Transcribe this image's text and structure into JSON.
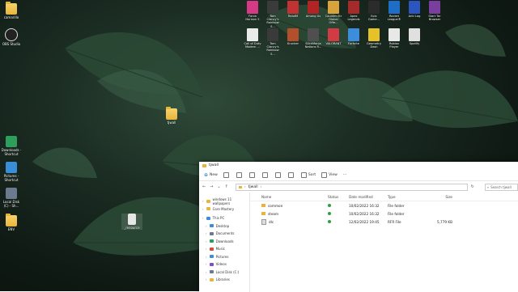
{
  "desktop_left": [
    {
      "label": "camarillo",
      "icon": "folder-icon"
    },
    {
      "label": "OBS Studio",
      "icon": "obs-icon"
    },
    {
      "label": "Downloads - Shortcut",
      "icon": "downloads-icon"
    },
    {
      "label": "Pictures - Shortcut",
      "icon": "pictures-icon"
    },
    {
      "label": "Local Disk (C) - Sh...",
      "icon": "disk-icon"
    },
    {
      "label": "ENV",
      "icon": "folder-icon"
    }
  ],
  "desktop_center": [
    {
      "label": "tjwall",
      "icon": "folder-icon"
    },
    {
      "label": "_resource",
      "icon": "file-icon"
    }
  ],
  "games_row1": [
    {
      "label": "Forza Horizon 5",
      "color": "#d63a87"
    },
    {
      "label": "Tom Clancy's Rainbow S...",
      "color": "#3b3b3b"
    },
    {
      "label": "ReadM",
      "color": "#c33232"
    },
    {
      "label": "Among Us",
      "color": "#b22323"
    },
    {
      "label": "Counter-Str Global Offe...",
      "color": "#d9a33b"
    },
    {
      "label": "Apex Legends",
      "color": "#a52a2a"
    },
    {
      "label": "Epic Game...",
      "color": "#2b2b2b"
    },
    {
      "label": "Rocket League®",
      "color": "#1e6ec8"
    },
    {
      "label": "Anti Lag",
      "color": "#2b55c0"
    },
    {
      "label": "Start Tor Browser",
      "color": "#7a3f9e"
    }
  ],
  "games_row2": [
    {
      "label": "Call of Duty Modern ...",
      "color": "#eaeaea"
    },
    {
      "label": "Tom Clancy's Rainbow S...",
      "color": "#3a3a3a"
    },
    {
      "label": "Krunker",
      "color": "#b44f2c"
    },
    {
      "label": "StickMania Nations R...",
      "color": "#4f4f4f"
    },
    {
      "label": "VALORANT",
      "color": "#d23a44"
    },
    {
      "label": "Fortnite",
      "color": "#3c8ddb"
    },
    {
      "label": "Geometry Dash",
      "color": "#e6c229"
    },
    {
      "label": "Roblox Player",
      "color": "#e8e8e8"
    },
    {
      "label": "Spotify",
      "color": "#e0e0e0"
    }
  ],
  "explorer": {
    "title": "tjwall",
    "new_label": "New",
    "sort_label": "Sort",
    "view_label": "View",
    "more_label": "···",
    "address": "tjwall",
    "search_placeholder": "Search tjwall",
    "nav": [
      {
        "label": "windows 11 wallpapers",
        "color": "#e8b53c"
      },
      {
        "label": "Core Mastery",
        "color": "#e8b53c"
      },
      {
        "label": "This PC",
        "color": "#3a8ed8"
      },
      {
        "label": "Desktop",
        "color": "#3a8ed8"
      },
      {
        "label": "Documents",
        "color": "#6b7a8f"
      },
      {
        "label": "Downloads",
        "color": "#2e9e5b"
      },
      {
        "label": "Music",
        "color": "#d44c3a"
      },
      {
        "label": "Pictures",
        "color": "#3a8ed8"
      },
      {
        "label": "Videos",
        "color": "#7c4fc4"
      },
      {
        "label": "Local Disk (C:)",
        "color": "#6b7a8f"
      },
      {
        "label": "Libraries",
        "color": "#e8b53c"
      }
    ],
    "columns": {
      "name": "Name",
      "status": "Status",
      "date": "Date modified",
      "type": "Type",
      "size": "Size"
    },
    "files": [
      {
        "name": "common",
        "date": "10/02/2022 16:32",
        "type": "File folder",
        "size": "",
        "kind": "folder"
      },
      {
        "name": "steam",
        "date": "10/02/2022 16:32",
        "type": "File folder",
        "size": "",
        "kind": "folder"
      },
      {
        "name": "dlc",
        "date": "12/02/2022 19:45",
        "type": "RFR File",
        "size": "5,779 KB",
        "kind": "file"
      }
    ]
  }
}
